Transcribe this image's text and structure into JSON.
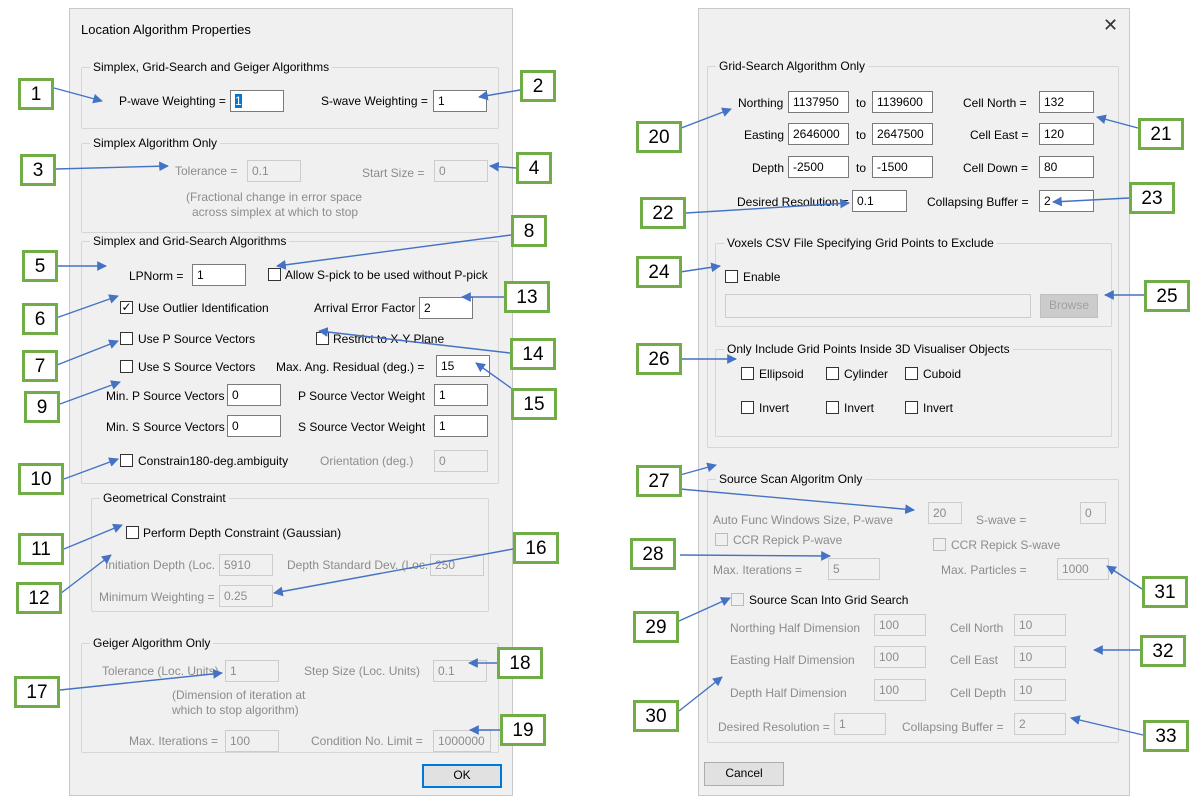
{
  "left_dialog": {
    "title": "Location Algorithm Properties",
    "g1": {
      "title": "Simplex, Grid-Search and Geiger Algorithms",
      "p_label": "P-wave Weighting =",
      "p_value": "1",
      "s_label": "S-wave Weighting =",
      "s_value": "1"
    },
    "g2": {
      "title": "Simplex Algorithm Only",
      "tol_label": "Tolerance =",
      "tol_value": "0.1",
      "start_label": "Start Size =",
      "start_value": "0",
      "note1": "(Fractional change in error space",
      "note2": "across simplex at which to stop"
    },
    "g3": {
      "title": "Simplex and Grid-Search Algorithms",
      "lpnorm_label": "LPNorm =",
      "lpnorm_value": "1",
      "allow_s": "Allow S-pick to be used without P-pick",
      "outlier": "Use Outlier Identification",
      "arrival_label": "Arrival Error Factor x",
      "arrival_value": "2",
      "use_p": "Use P Source Vectors",
      "restrict": "Restrict to X-Y Plane",
      "use_s": "Use S Source Vectors",
      "maxang_label": "Max. Ang. Residual (deg.) =",
      "maxang_value": "15",
      "minp_label": "Min. P Source Vectors",
      "minp_value": "0",
      "pweight_label": "P Source Vector Weight",
      "pweight_value": "1",
      "mins_label": "Min. S Source Vectors",
      "mins_value": "0",
      "sweight_label": "S Source Vector Weight",
      "sweight_value": "1",
      "constrain": "Constrain180-deg.ambiguity",
      "orient_label": "Orientation (deg.)",
      "orient_value": "0"
    },
    "g4": {
      "title": "Geometrical Constraint",
      "perform": "Perform Depth Constraint (Gaussian)",
      "init_label": "Initiation Depth (Loc.",
      "init_value": "5910",
      "dstd_label": "Depth Standard Dev. (Loc.",
      "dstd_value": "250",
      "minw_label": "Minimum Weighting =",
      "minw_value": "0.25"
    },
    "g5": {
      "title": "Geiger Algorithm Only",
      "tol_label": "Tolerance (Loc. Units)",
      "tol_value": "1",
      "step_label": "Step Size (Loc. Units)",
      "step_value": "0.1",
      "note1": "(Dimension of iteration at",
      "note2": "which to stop algorithm)",
      "maxit_label": "Max. Iterations =",
      "maxit_value": "100",
      "cond_label": "Condition No. Limit =",
      "cond_value": "1000000"
    },
    "ok": "OK"
  },
  "right_dialog": {
    "close": "✕",
    "grid": {
      "title": "Grid-Search Algorithm Only",
      "northing_label": "Northing",
      "northing_from": "1137950",
      "northing_to": "1139600",
      "easting_label": "Easting",
      "easting_from": "2646000",
      "easting_to": "2647500",
      "depth_label": "Depth",
      "depth_from": "-2500",
      "depth_to": "-1500",
      "to": "to",
      "cn_label": "Cell North =",
      "cn_value": "132",
      "ce_label": "Cell East =",
      "ce_value": "120",
      "cd_label": "Cell Down =",
      "cd_value": "80",
      "res_label": "Desired Resolution =",
      "res_value": "0.1",
      "buf_label": "Collapsing Buffer =",
      "buf_value": "2"
    },
    "voxels": {
      "title": "Voxels CSV File Specifying Grid Points to Exclude",
      "enable": "Enable",
      "browse": "Browse"
    },
    "only": {
      "title": "Only Include Grid Points Inside 3D Visualiser Objects",
      "ellipsoid": "Ellipsoid",
      "cylinder": "Cylinder",
      "cuboid": "Cuboid",
      "invert": "Invert"
    },
    "scan": {
      "title": "Source Scan Algoritm Only",
      "autofunc_label": "Auto Func Windows Size, P-wave",
      "autofunc_value": "20",
      "swave_label": "S-wave =",
      "swave_value": "0",
      "ccrp": "CCR Repick P-wave",
      "ccrs": "CCR Repick S-wave",
      "maxit_label": "Max. Iterations =",
      "maxit_value": "5",
      "maxpart_label": "Max. Particles =",
      "maxpart_value": "1000",
      "into_grid": "Source Scan Into Grid Search",
      "nhd_label": "Northing Half Dimension",
      "nhd_value": "100",
      "cn_label": "Cell North",
      "cn_value": "10",
      "ehd_label": "Easting Half Dimension",
      "ehd_value": "100",
      "ce_label": "Cell East",
      "ce_value": "10",
      "dhd_label": "Depth Half Dimension",
      "dhd_value": "100",
      "cd_label": "Cell Depth",
      "cd_value": "10",
      "res_label": "Desired Resolution =",
      "res_value": "1",
      "buf_label": "Collapsing Buffer =",
      "buf_value": "2"
    },
    "cancel": "Cancel"
  },
  "callouts": [
    "1",
    "2",
    "3",
    "4",
    "5",
    "6",
    "7",
    "8",
    "9",
    "10",
    "11",
    "12",
    "13",
    "14",
    "15",
    "16",
    "17",
    "18",
    "19",
    "20",
    "21",
    "22",
    "23",
    "24",
    "25",
    "26",
    "27",
    "28",
    "29",
    "30",
    "31",
    "32",
    "33"
  ],
  "colors": {
    "callout_border": "#70ad47",
    "arrow": "#4472c4",
    "dialog_bg": "#f0f0f0",
    "focus": "#0078d7"
  }
}
